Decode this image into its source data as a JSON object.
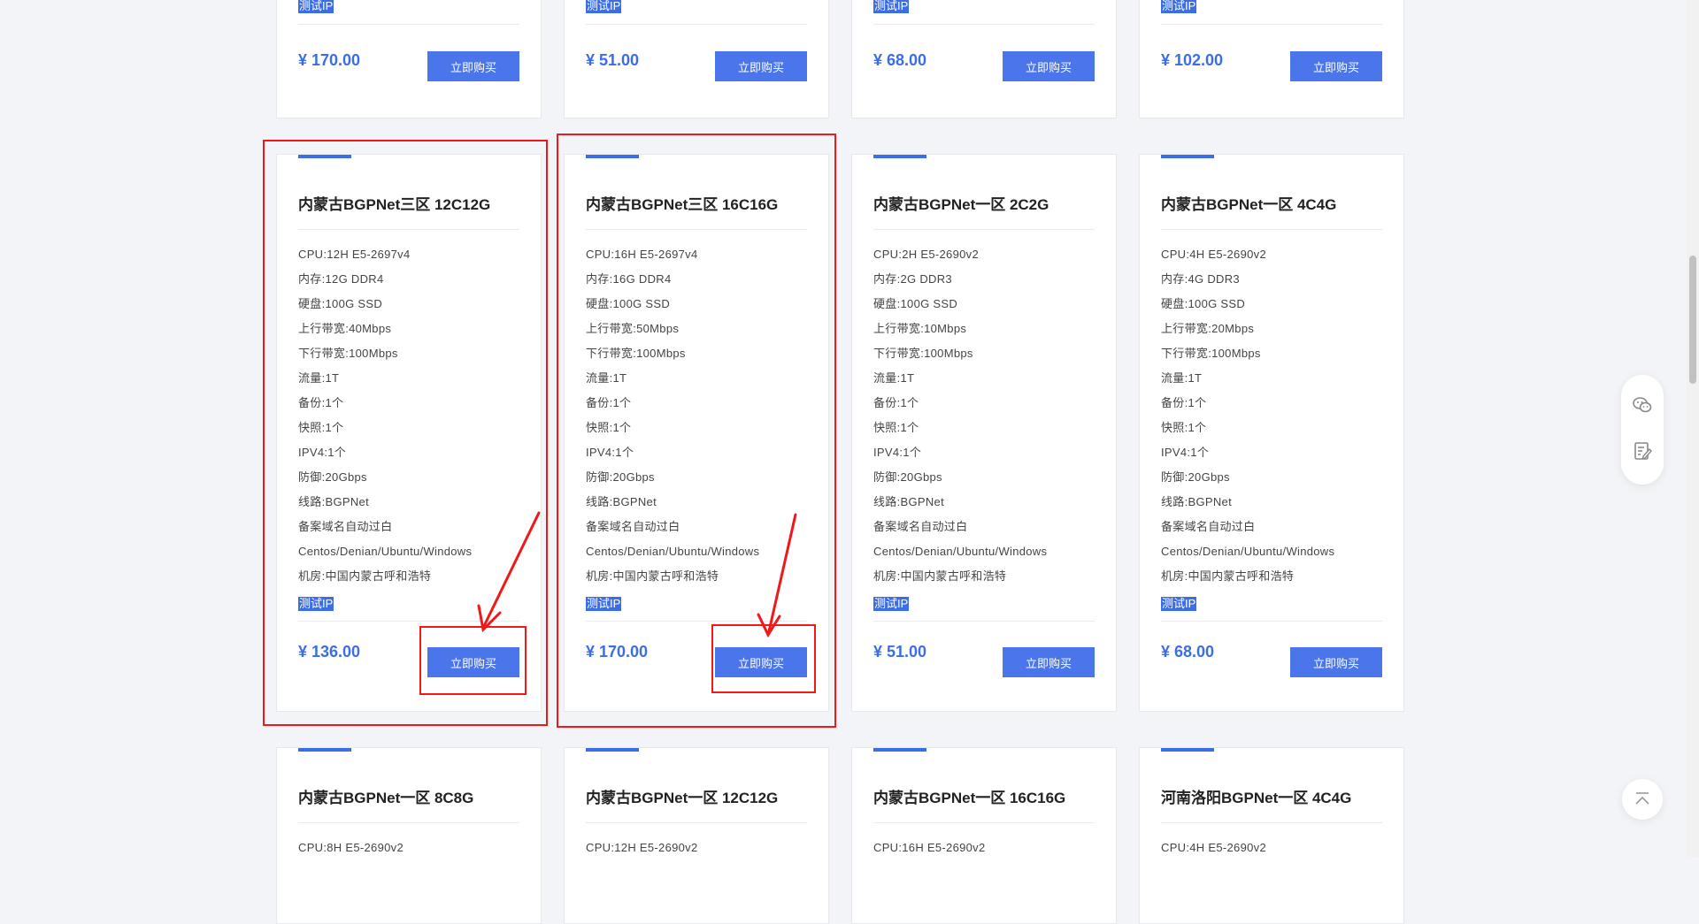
{
  "buy_label": "立即购买",
  "test_ip_label": "测试IP",
  "top_row": [
    {
      "price": "¥ 170.00"
    },
    {
      "price": "¥ 51.00"
    },
    {
      "price": "¥ 68.00"
    },
    {
      "price": "¥ 102.00"
    }
  ],
  "middle_row": [
    {
      "name": "内蒙古BGPNet三区 12C12G",
      "specs": [
        "CPU:12H E5-2697v4",
        "内存:12G DDR4",
        "硬盘:100G SSD",
        "上行带宽:40Mbps",
        "下行带宽:100Mbps",
        "流量:1T",
        "备份:1个",
        "快照:1个",
        "IPV4:1个",
        "防御:20Gbps",
        "线路:BGPNet",
        "备案域名自动过白",
        "Centos/Denian/Ubuntu/Windows",
        "机房:中国内蒙古呼和浩特"
      ],
      "price": "¥ 136.00"
    },
    {
      "name": "内蒙古BGPNet三区 16C16G",
      "specs": [
        "CPU:16H E5-2697v4",
        "内存:16G DDR4",
        "硬盘:100G SSD",
        "上行带宽:50Mbps",
        "下行带宽:100Mbps",
        "流量:1T",
        "备份:1个",
        "快照:1个",
        "IPV4:1个",
        "防御:20Gbps",
        "线路:BGPNet",
        "备案域名自动过白",
        "Centos/Denian/Ubuntu/Windows",
        "机房:中国内蒙古呼和浩特"
      ],
      "price": "¥ 170.00"
    },
    {
      "name": "内蒙古BGPNet一区 2C2G",
      "specs": [
        "CPU:2H E5-2690v2",
        "内存:2G DDR3",
        "硬盘:100G SSD",
        "上行带宽:10Mbps",
        "下行带宽:100Mbps",
        "流量:1T",
        "备份:1个",
        "快照:1个",
        "IPV4:1个",
        "防御:20Gbps",
        "线路:BGPNet",
        "备案域名自动过白",
        "Centos/Denian/Ubuntu/Windows",
        "机房:中国内蒙古呼和浩特"
      ],
      "price": "¥ 51.00"
    },
    {
      "name": "内蒙古BGPNet一区 4C4G",
      "specs": [
        "CPU:4H E5-2690v2",
        "内存:4G DDR3",
        "硬盘:100G SSD",
        "上行带宽:20Mbps",
        "下行带宽:100Mbps",
        "流量:1T",
        "备份:1个",
        "快照:1个",
        "IPV4:1个",
        "防御:20Gbps",
        "线路:BGPNet",
        "备案域名自动过白",
        "Centos/Denian/Ubuntu/Windows",
        "机房:中国内蒙古呼和浩特"
      ],
      "price": "¥ 68.00"
    }
  ],
  "bottom_row": [
    {
      "name": "内蒙古BGPNet一区 8C8G",
      "cpu": "CPU:8H E5-2690v2"
    },
    {
      "name": "内蒙古BGPNet一区 12C12G",
      "cpu": "CPU:12H E5-2690v2"
    },
    {
      "name": "内蒙古BGPNet一区 16C16G",
      "cpu": "CPU:16H E5-2690v2"
    },
    {
      "name": "河南洛阳BGPNet一区 4C4G",
      "cpu": "CPU:4H E5-2690v2"
    }
  ],
  "icons": {
    "wechat": "wechat-icon",
    "feedback": "edit-note-icon",
    "back_to_top": "arrow-up-icon"
  },
  "colors": {
    "accent": "#3b6ee6",
    "button": "#4b75ea",
    "annotation": "#f01818"
  }
}
